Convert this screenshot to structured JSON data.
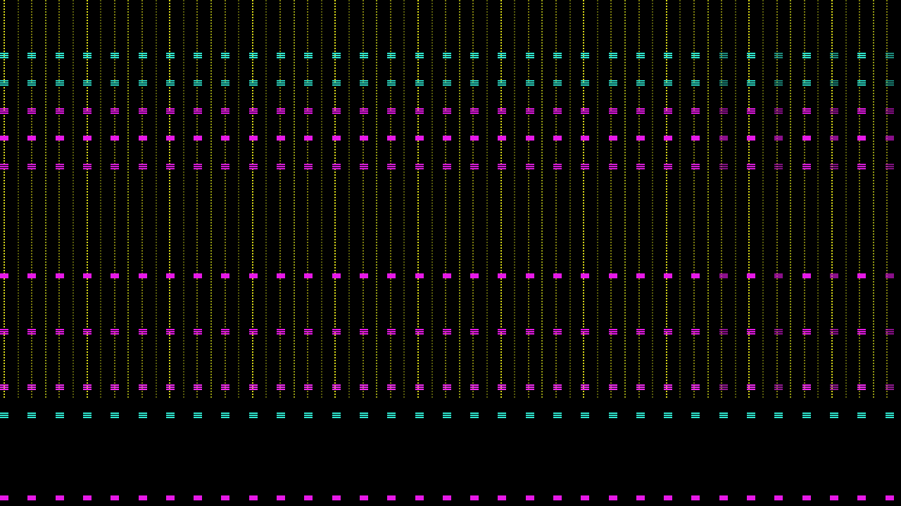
{
  "screen": {
    "background": "#000000",
    "stripe_colors": [
      "#e6e619",
      "#9ea514"
    ],
    "rows": [
      {
        "name": "cyan-row-1",
        "color": "#2ee6cf",
        "style": "lines"
      },
      {
        "name": "cyan-row-2",
        "color": "#2ad0bd",
        "style": "lines"
      },
      {
        "name": "magenta-row-1",
        "color": "#e619e6",
        "style": "lines"
      },
      {
        "name": "magenta-row-2",
        "color": "#e619e6",
        "style": "solid"
      },
      {
        "name": "magenta-row-3",
        "color": "#d619d6",
        "style": "lines"
      },
      {
        "name": "magenta-row-4",
        "color": "#e619e6",
        "style": "solid"
      },
      {
        "name": "magenta-row-5",
        "color": "#e619e6",
        "style": "lines"
      },
      {
        "name": "magenta-row-6",
        "color": "#f22af2",
        "style": "lines"
      },
      {
        "name": "cyan-row-3",
        "color": "#2ee6cf",
        "style": "lines"
      },
      {
        "name": "magenta-row-7",
        "color": "#e619e6",
        "style": "solid"
      }
    ]
  }
}
